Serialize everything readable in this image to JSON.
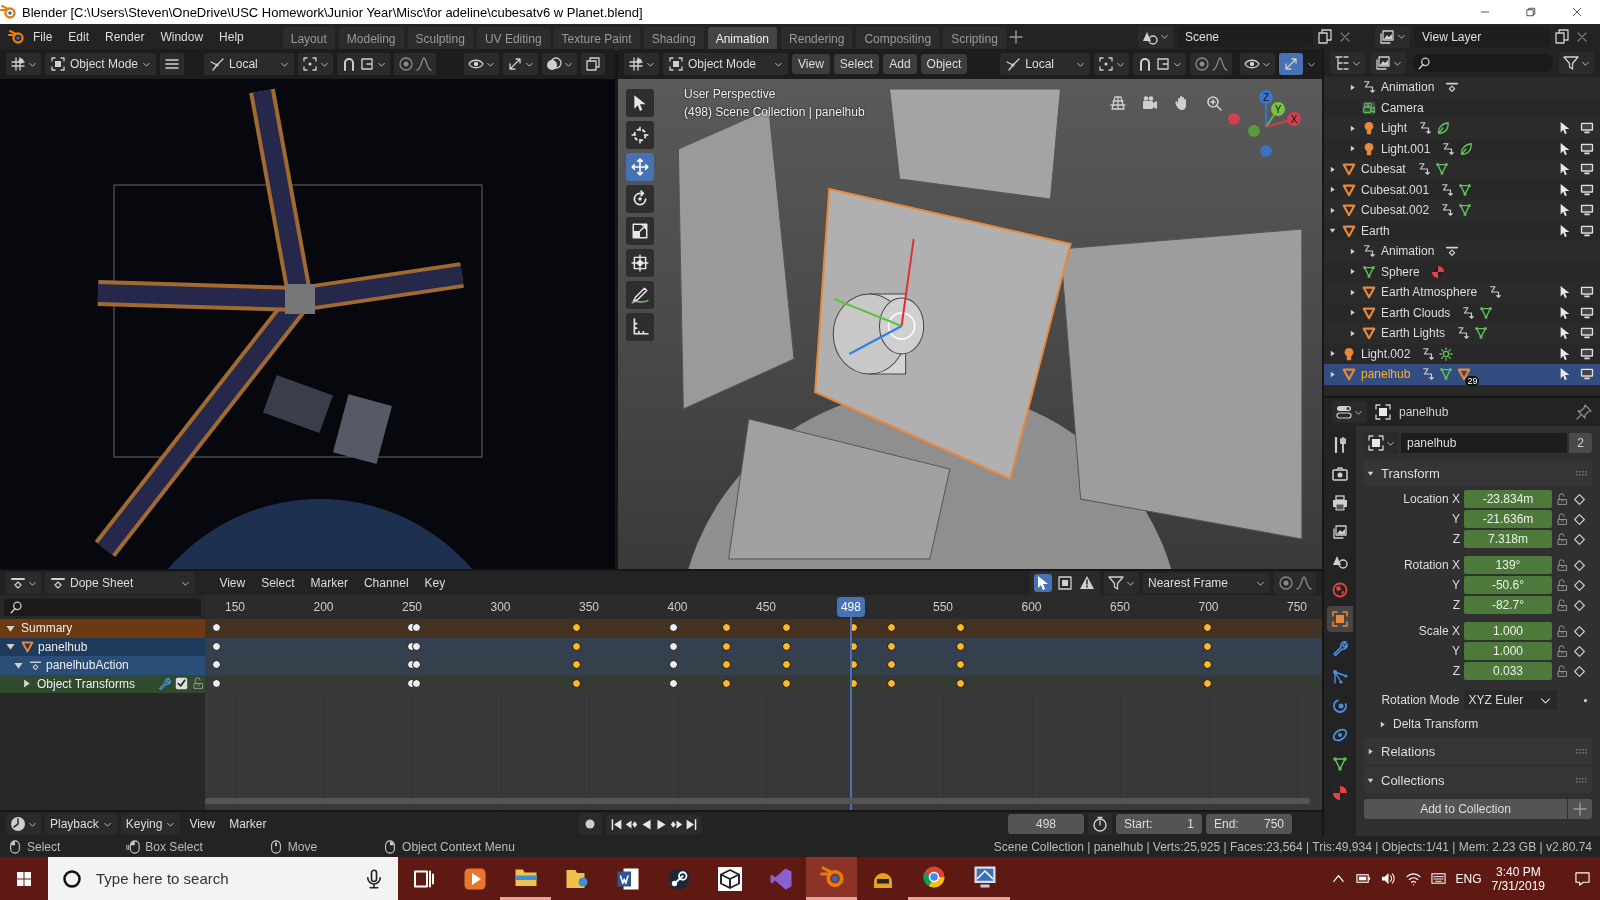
{
  "window": {
    "title": "Blender [C:\\Users\\Steven\\OneDrive\\USC Homework\\Junior Year\\Misc\\for adeline\\cubesatv6 w Planet.blend]"
  },
  "menu": [
    "File",
    "Edit",
    "Render",
    "Window",
    "Help"
  ],
  "workspaces": [
    {
      "label": "Layout",
      "selected": false
    },
    {
      "label": "Modeling",
      "selected": false
    },
    {
      "label": "Sculpting",
      "selected": false
    },
    {
      "label": "UV Editing",
      "selected": false
    },
    {
      "label": "Texture Paint",
      "selected": false
    },
    {
      "label": "Shading",
      "selected": false
    },
    {
      "label": "Animation",
      "selected": true
    },
    {
      "label": "Rendering",
      "selected": false
    },
    {
      "label": "Compositing",
      "selected": false
    },
    {
      "label": "Scripting",
      "selected": false
    }
  ],
  "scene": "Scene",
  "view_layer": "View Layer",
  "viewport_left": {
    "mode": "Object Mode",
    "orientation": "Local"
  },
  "viewport_right": {
    "mode": "Object Mode",
    "menu": [
      "View",
      "Select",
      "Add",
      "Object"
    ],
    "orientation": "Local",
    "title": "User Perspective",
    "info": "(498) Scene Collection | panelhub",
    "gizmo": [
      "Z",
      "Y",
      "X"
    ],
    "tools": [
      {
        "kind": "select",
        "selected": false
      },
      {
        "kind": "cursor",
        "selected": false
      },
      {
        "kind": "move",
        "selected": true
      },
      {
        "kind": "rotate",
        "selected": false
      },
      {
        "kind": "scale",
        "selected": false
      },
      {
        "kind": "transform",
        "selected": false
      },
      {
        "kind": "annotate",
        "selected": false
      },
      {
        "kind": "measure",
        "selected": false
      }
    ]
  },
  "outliner": {
    "items": [
      {
        "children": [
          {
            "name": "Animation",
            "kind": "action",
            "expanded": false,
            "selected": false,
            "icons": [
              {
                "kind": "keyframes"
              }
            ],
            "restrict": false
          },
          {
            "name": "Camera",
            "kind": "camera",
            "selected": false,
            "restrict": false
          },
          {
            "name": "Light",
            "kind": "light",
            "expanded": false,
            "selected": false,
            "icons": [
              {
                "kind": "modifier"
              },
              {
                "kind": "spot"
              }
            ],
            "restrict": true
          },
          {
            "name": "Light.001",
            "kind": "light",
            "expanded": false,
            "selected": false,
            "icons": [
              {
                "kind": "modifier"
              },
              {
                "kind": "spot"
              }
            ],
            "restrict": true
          }
        ]
      },
      {
        "name": "Cubesat",
        "kind": "mesh",
        "expanded": false,
        "selected": false,
        "icons": [
          {
            "kind": "modifier"
          },
          {
            "kind": "mesh-data"
          }
        ],
        "restrict": true
      },
      {
        "name": "Cubesat.001",
        "kind": "mesh",
        "expanded": false,
        "selected": false,
        "icons": [
          {
            "kind": "modifier"
          },
          {
            "kind": "mesh-data"
          }
        ],
        "restrict": true
      },
      {
        "name": "Cubesat.002",
        "kind": "mesh",
        "expanded": false,
        "selected": false,
        "icons": [
          {
            "kind": "modifier"
          },
          {
            "kind": "mesh-data"
          }
        ],
        "restrict": true
      },
      {
        "name": "Earth",
        "kind": "mesh",
        "expanded": true,
        "selected": false,
        "restrict": true,
        "children": [
          {
            "name": "Animation",
            "kind": "action",
            "expanded": false,
            "selected": false,
            "icons": [
              {
                "kind": "keyframes"
              }
            ],
            "restrict": false
          },
          {
            "name": "Sphere",
            "kind": "mesh-data",
            "expanded": false,
            "selected": false,
            "icons": [
              {
                "kind": "material"
              }
            ],
            "restrict": false
          },
          {
            "name": "Earth Atmosphere",
            "kind": "mesh",
            "expanded": false,
            "selected": false,
            "icons": [
              {
                "kind": "modifier"
              }
            ],
            "restrict": true
          },
          {
            "name": "Earth Clouds",
            "kind": "mesh",
            "expanded": false,
            "selected": false,
            "icons": [
              {
                "kind": "modifier"
              },
              {
                "kind": "mesh-data"
              }
            ],
            "restrict": true
          },
          {
            "name": "Earth Lights",
            "kind": "mesh",
            "expanded": false,
            "selected": false,
            "icons": [
              {
                "kind": "modifier"
              },
              {
                "kind": "mesh-data"
              }
            ],
            "restrict": true
          }
        ]
      },
      {
        "name": "Light.002",
        "kind": "light",
        "expanded": false,
        "selected": false,
        "icons": [
          {
            "kind": "modifier"
          },
          {
            "kind": "sun"
          }
        ],
        "restrict": true
      },
      {
        "name": "panelhub",
        "kind": "mesh",
        "expanded": false,
        "selected": true,
        "icons": [
          {
            "kind": "modifier"
          },
          {
            "kind": "mesh-data"
          },
          {
            "kind": "mesh"
          }
        ],
        "badge": "29",
        "restrict": true
      }
    ]
  },
  "properties": {
    "object": "panelhub",
    "tabs": [
      {
        "kind": "tool",
        "selected": false
      },
      {
        "kind": "render",
        "selected": false
      },
      {
        "kind": "output",
        "selected": false
      },
      {
        "kind": "view-layer",
        "selected": false
      },
      {
        "kind": "scene",
        "selected": false
      },
      {
        "kind": "world",
        "selected": false
      },
      {
        "kind": "object",
        "selected": true
      },
      {
        "kind": "modifier",
        "selected": false
      },
      {
        "kind": "particles",
        "selected": false
      },
      {
        "kind": "physics",
        "selected": false
      },
      {
        "kind": "constraint",
        "selected": false
      },
      {
        "kind": "data",
        "selected": false
      },
      {
        "kind": "material",
        "selected": false
      }
    ],
    "name": "panelhub",
    "users": "2",
    "transform": {
      "title": "Transform",
      "expanded": true,
      "groups": [
        [
          {
            "label": "Location X",
            "value": "-23.834m",
            "animated": true
          },
          {
            "label": "Y",
            "value": "-21.636m",
            "animated": true
          },
          {
            "label": "Z",
            "value": "7.318m",
            "animated": true
          }
        ],
        [
          {
            "label": "Rotation X",
            "value": "139°",
            "animated": true
          },
          {
            "label": "Y",
            "value": "-50.6°",
            "animated": true
          },
          {
            "label": "Z",
            "value": "-82.7°",
            "animated": true
          }
        ],
        [
          {
            "label": "Scale X",
            "value": "1.000",
            "animated": true
          },
          {
            "label": "Y",
            "value": "1.000",
            "animated": true
          },
          {
            "label": "Z",
            "value": "0.033",
            "animated": true
          }
        ]
      ],
      "mode_label": "Rotation Mode",
      "mode": "XYZ Euler",
      "subpanel": {
        "title": "Delta Transform",
        "expanded": false
      }
    },
    "relations": {
      "title": "Relations",
      "expanded": false
    },
    "collections": {
      "title": "Collections",
      "expanded": true,
      "button": "Add to Collection"
    }
  },
  "dopesheet": {
    "editor": "Dope Sheet",
    "menu": [
      "View",
      "Select",
      "Marker",
      "Channel",
      "Key"
    ],
    "snap": "Nearest Frame",
    "filters": [
      {
        "kind": "selected-only",
        "on": true
      },
      {
        "kind": "hidden",
        "on": false
      },
      {
        "kind": "errors",
        "on": false
      }
    ],
    "ruler": [
      "150",
      "200",
      "250",
      "300",
      "350",
      "400",
      "450",
      "550",
      "600",
      "650",
      "700",
      "750"
    ],
    "current_frame": "498",
    "channels": [
      {
        "name": "Summary",
        "kind": "summary",
        "expanded": true
      },
      {
        "name": "panelhub",
        "kind": "object",
        "expanded": true
      },
      {
        "name": "panelhubAction",
        "kind": "action",
        "expanded": true
      },
      {
        "name": "Object Transforms",
        "kind": "group",
        "expanded": false,
        "enabled": true
      }
    ],
    "keyframes": [
      {
        "level": 0.011,
        "selected": false
      },
      {
        "level": 0.185,
        "selected": false
      },
      {
        "level": 0.19,
        "selected": false
      },
      {
        "level": 0.333,
        "selected": true
      },
      {
        "level": 0.42,
        "selected": false
      },
      {
        "level": 0.467,
        "selected": true
      },
      {
        "level": 0.521,
        "selected": true
      },
      {
        "level": 0.581,
        "selected": true
      },
      {
        "level": 0.615,
        "selected": true
      },
      {
        "level": 0.677,
        "selected": true
      },
      {
        "level": 0.898,
        "selected": true
      }
    ]
  },
  "timeline": {
    "menu": [
      "Playback",
      "Keying",
      "View",
      "Marker"
    ],
    "current_frame": "498",
    "start_label": "Start:",
    "start": "1",
    "end_label": "End:",
    "end": "750"
  },
  "status_bar": {
    "hints": [
      {
        "kind": "left",
        "label": "Select"
      },
      {
        "kind": "drag",
        "label": "Box Select"
      },
      {
        "kind": "middle",
        "label": "Move"
      },
      {
        "kind": "right",
        "label": "Object Context Menu"
      }
    ],
    "stats": "Scene Collection | panelhub | Verts:25,925 | Faces:23,564 | Tris:49,934 | Objects:1/41 | Mem: 2.23 GB | v2.80.74"
  },
  "taskbar": {
    "placeholder": "Type here to search",
    "apps": [
      {
        "kind": "task-view",
        "open": false,
        "active": false
      },
      {
        "kind": "media",
        "open": false,
        "active": false
      },
      {
        "kind": "explorer",
        "open": true,
        "active": false
      },
      {
        "kind": "files",
        "open": false,
        "active": false
      },
      {
        "kind": "word",
        "open": false,
        "active": false
      },
      {
        "kind": "steam",
        "open": false,
        "active": false
      },
      {
        "kind": "unity",
        "open": false,
        "active": false
      },
      {
        "kind": "studio",
        "open": false,
        "active": false
      },
      {
        "kind": "blender",
        "open": true,
        "active": true
      },
      {
        "kind": "helmet",
        "open": false,
        "active": false
      },
      {
        "kind": "chrome",
        "open": true,
        "active": false
      },
      {
        "kind": "remote",
        "open": true,
        "active": false
      }
    ],
    "language": "ENG",
    "time": "3:40 PM",
    "date": "7/31/2019"
  }
}
